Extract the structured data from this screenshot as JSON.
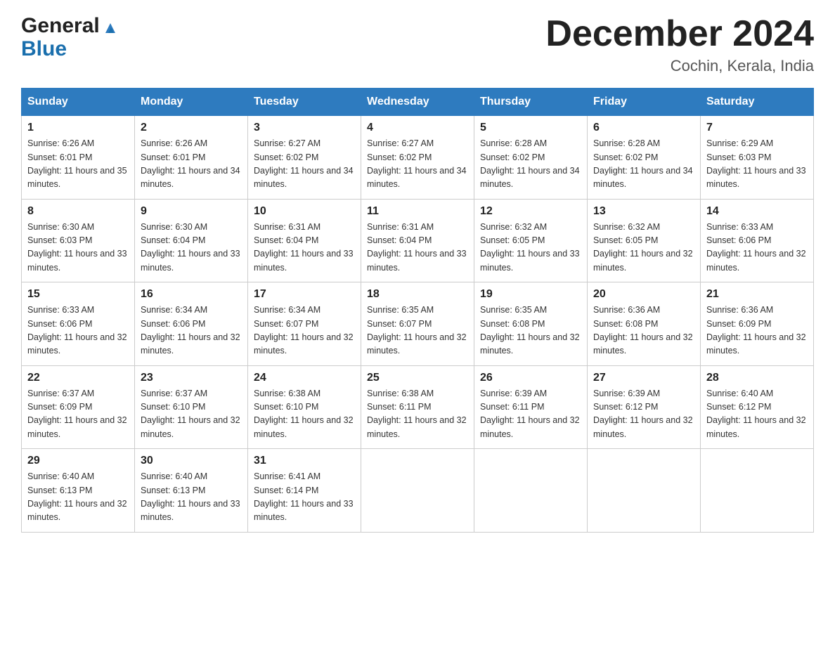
{
  "header": {
    "logo_general": "General",
    "logo_blue": "Blue",
    "month_title": "December 2024",
    "location": "Cochin, Kerala, India"
  },
  "days_of_week": [
    "Sunday",
    "Monday",
    "Tuesday",
    "Wednesday",
    "Thursday",
    "Friday",
    "Saturday"
  ],
  "weeks": [
    [
      {
        "day": "1",
        "sunrise": "Sunrise: 6:26 AM",
        "sunset": "Sunset: 6:01 PM",
        "daylight": "Daylight: 11 hours and 35 minutes."
      },
      {
        "day": "2",
        "sunrise": "Sunrise: 6:26 AM",
        "sunset": "Sunset: 6:01 PM",
        "daylight": "Daylight: 11 hours and 34 minutes."
      },
      {
        "day": "3",
        "sunrise": "Sunrise: 6:27 AM",
        "sunset": "Sunset: 6:02 PM",
        "daylight": "Daylight: 11 hours and 34 minutes."
      },
      {
        "day": "4",
        "sunrise": "Sunrise: 6:27 AM",
        "sunset": "Sunset: 6:02 PM",
        "daylight": "Daylight: 11 hours and 34 minutes."
      },
      {
        "day": "5",
        "sunrise": "Sunrise: 6:28 AM",
        "sunset": "Sunset: 6:02 PM",
        "daylight": "Daylight: 11 hours and 34 minutes."
      },
      {
        "day": "6",
        "sunrise": "Sunrise: 6:28 AM",
        "sunset": "Sunset: 6:02 PM",
        "daylight": "Daylight: 11 hours and 34 minutes."
      },
      {
        "day": "7",
        "sunrise": "Sunrise: 6:29 AM",
        "sunset": "Sunset: 6:03 PM",
        "daylight": "Daylight: 11 hours and 33 minutes."
      }
    ],
    [
      {
        "day": "8",
        "sunrise": "Sunrise: 6:30 AM",
        "sunset": "Sunset: 6:03 PM",
        "daylight": "Daylight: 11 hours and 33 minutes."
      },
      {
        "day": "9",
        "sunrise": "Sunrise: 6:30 AM",
        "sunset": "Sunset: 6:04 PM",
        "daylight": "Daylight: 11 hours and 33 minutes."
      },
      {
        "day": "10",
        "sunrise": "Sunrise: 6:31 AM",
        "sunset": "Sunset: 6:04 PM",
        "daylight": "Daylight: 11 hours and 33 minutes."
      },
      {
        "day": "11",
        "sunrise": "Sunrise: 6:31 AM",
        "sunset": "Sunset: 6:04 PM",
        "daylight": "Daylight: 11 hours and 33 minutes."
      },
      {
        "day": "12",
        "sunrise": "Sunrise: 6:32 AM",
        "sunset": "Sunset: 6:05 PM",
        "daylight": "Daylight: 11 hours and 33 minutes."
      },
      {
        "day": "13",
        "sunrise": "Sunrise: 6:32 AM",
        "sunset": "Sunset: 6:05 PM",
        "daylight": "Daylight: 11 hours and 32 minutes."
      },
      {
        "day": "14",
        "sunrise": "Sunrise: 6:33 AM",
        "sunset": "Sunset: 6:06 PM",
        "daylight": "Daylight: 11 hours and 32 minutes."
      }
    ],
    [
      {
        "day": "15",
        "sunrise": "Sunrise: 6:33 AM",
        "sunset": "Sunset: 6:06 PM",
        "daylight": "Daylight: 11 hours and 32 minutes."
      },
      {
        "day": "16",
        "sunrise": "Sunrise: 6:34 AM",
        "sunset": "Sunset: 6:06 PM",
        "daylight": "Daylight: 11 hours and 32 minutes."
      },
      {
        "day": "17",
        "sunrise": "Sunrise: 6:34 AM",
        "sunset": "Sunset: 6:07 PM",
        "daylight": "Daylight: 11 hours and 32 minutes."
      },
      {
        "day": "18",
        "sunrise": "Sunrise: 6:35 AM",
        "sunset": "Sunset: 6:07 PM",
        "daylight": "Daylight: 11 hours and 32 minutes."
      },
      {
        "day": "19",
        "sunrise": "Sunrise: 6:35 AM",
        "sunset": "Sunset: 6:08 PM",
        "daylight": "Daylight: 11 hours and 32 minutes."
      },
      {
        "day": "20",
        "sunrise": "Sunrise: 6:36 AM",
        "sunset": "Sunset: 6:08 PM",
        "daylight": "Daylight: 11 hours and 32 minutes."
      },
      {
        "day": "21",
        "sunrise": "Sunrise: 6:36 AM",
        "sunset": "Sunset: 6:09 PM",
        "daylight": "Daylight: 11 hours and 32 minutes."
      }
    ],
    [
      {
        "day": "22",
        "sunrise": "Sunrise: 6:37 AM",
        "sunset": "Sunset: 6:09 PM",
        "daylight": "Daylight: 11 hours and 32 minutes."
      },
      {
        "day": "23",
        "sunrise": "Sunrise: 6:37 AM",
        "sunset": "Sunset: 6:10 PM",
        "daylight": "Daylight: 11 hours and 32 minutes."
      },
      {
        "day": "24",
        "sunrise": "Sunrise: 6:38 AM",
        "sunset": "Sunset: 6:10 PM",
        "daylight": "Daylight: 11 hours and 32 minutes."
      },
      {
        "day": "25",
        "sunrise": "Sunrise: 6:38 AM",
        "sunset": "Sunset: 6:11 PM",
        "daylight": "Daylight: 11 hours and 32 minutes."
      },
      {
        "day": "26",
        "sunrise": "Sunrise: 6:39 AM",
        "sunset": "Sunset: 6:11 PM",
        "daylight": "Daylight: 11 hours and 32 minutes."
      },
      {
        "day": "27",
        "sunrise": "Sunrise: 6:39 AM",
        "sunset": "Sunset: 6:12 PM",
        "daylight": "Daylight: 11 hours and 32 minutes."
      },
      {
        "day": "28",
        "sunrise": "Sunrise: 6:40 AM",
        "sunset": "Sunset: 6:12 PM",
        "daylight": "Daylight: 11 hours and 32 minutes."
      }
    ],
    [
      {
        "day": "29",
        "sunrise": "Sunrise: 6:40 AM",
        "sunset": "Sunset: 6:13 PM",
        "daylight": "Daylight: 11 hours and 32 minutes."
      },
      {
        "day": "30",
        "sunrise": "Sunrise: 6:40 AM",
        "sunset": "Sunset: 6:13 PM",
        "daylight": "Daylight: 11 hours and 33 minutes."
      },
      {
        "day": "31",
        "sunrise": "Sunrise: 6:41 AM",
        "sunset": "Sunset: 6:14 PM",
        "daylight": "Daylight: 11 hours and 33 minutes."
      },
      null,
      null,
      null,
      null
    ]
  ]
}
